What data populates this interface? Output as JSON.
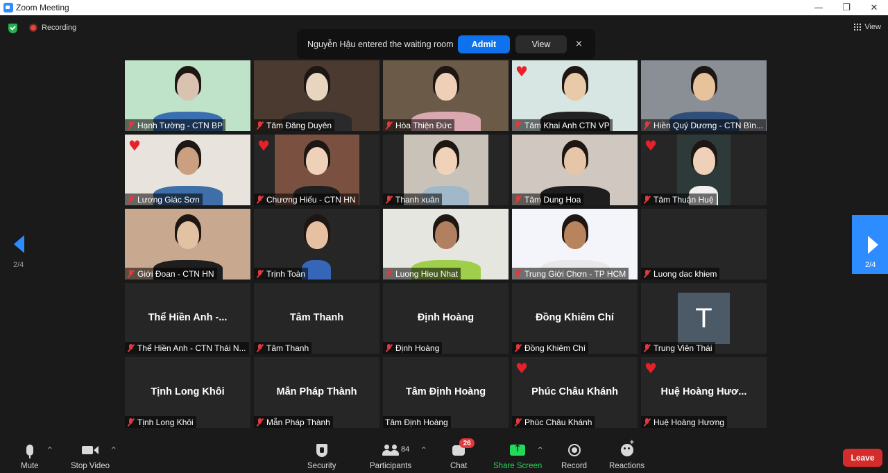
{
  "window": {
    "title": "Zoom Meeting",
    "controls": [
      "—",
      "❐",
      "✕"
    ]
  },
  "topbar": {
    "recording_label": "Recording",
    "view_label": "View"
  },
  "notice": {
    "message": "Nguyễn Hậu entered the waiting room",
    "admit_label": "Admit",
    "view_label": "View",
    "close_glyph": "×"
  },
  "pagination": {
    "left": "2/4",
    "right": "2/4"
  },
  "participants": [
    {
      "label": "Hạnh Tường - CTN BP",
      "video": true,
      "reaction": false
    },
    {
      "label": "Tâm Đăng Duyên",
      "video": true,
      "reaction": false
    },
    {
      "label": "Hòa Thiện Đức",
      "video": true,
      "reaction": false
    },
    {
      "label": "Tâm Khai Anh CTN VP",
      "video": true,
      "reaction": true
    },
    {
      "label": "Hiền Quý Dương - CTN Bìn...",
      "video": true,
      "reaction": false
    },
    {
      "label": "Lương Giác Sơn",
      "video": true,
      "reaction": true
    },
    {
      "label": "Chương Hiếu - CTN HN",
      "video": true,
      "reaction": true
    },
    {
      "label": "Thanh xuân",
      "video": true,
      "reaction": false
    },
    {
      "label": "Tâm Dung Hoa",
      "video": true,
      "reaction": false
    },
    {
      "label": "Tâm Thuận Huệ",
      "video": true,
      "reaction": true
    },
    {
      "label": "Giới Đoan - CTN HN",
      "video": true,
      "reaction": false
    },
    {
      "label": "Trịnh Toàn",
      "video": true,
      "reaction": false
    },
    {
      "label": "Luong Hieu Nhat",
      "video": true,
      "reaction": false
    },
    {
      "label": "Trung Giới Chơn - TP HCM",
      "video": true,
      "reaction": false
    },
    {
      "label": "Luong dac khiem",
      "video": false,
      "reaction": false,
      "big_name": ""
    },
    {
      "label": "Thể Hiền Anh - CTN Thái N...",
      "video": false,
      "reaction": false,
      "big_name": "Thể Hiền Anh -..."
    },
    {
      "label": "Tâm Thanh",
      "video": false,
      "reaction": false,
      "big_name": "Tâm Thanh"
    },
    {
      "label": "Định Hoàng",
      "video": false,
      "reaction": false,
      "big_name": "Định Hoàng"
    },
    {
      "label": "Đồng Khiêm Chí",
      "video": false,
      "reaction": false,
      "big_name": "Đồng Khiêm Chí"
    },
    {
      "label": "Trung Viên Thái",
      "video": false,
      "reaction": false,
      "big_name": "",
      "avatar_letter": "T"
    },
    {
      "label": "Tịnh Long Khôi",
      "video": false,
      "reaction": false,
      "big_name": "Tịnh Long Khôi"
    },
    {
      "label": "Mẫn Pháp Thành",
      "video": false,
      "reaction": false,
      "big_name": "Mẫn Pháp Thành"
    },
    {
      "label": "Tâm Định Hoàng",
      "video": false,
      "reaction": false,
      "big_name": "Tâm Định Hoàng",
      "unmuted": true
    },
    {
      "label": "Phúc Châu Khánh",
      "video": false,
      "reaction": true,
      "big_name": "Phúc Châu Khánh"
    },
    {
      "label": "Huệ Hoàng Hương",
      "video": false,
      "reaction": true,
      "big_name": "Huệ  Hoàng  Hươ..."
    }
  ],
  "toolbar": {
    "mute": "Mute",
    "stop_video": "Stop Video",
    "security": "Security",
    "participants": "Participants",
    "participants_count": "84",
    "chat": "Chat",
    "chat_badge": "26",
    "share_screen": "Share Screen",
    "record": "Record",
    "reactions": "Reactions",
    "leave": "Leave"
  },
  "colors": {
    "accent": "#2d8cff",
    "admit": "#0e72ed",
    "leave": "#d62b2b",
    "share": "#23d959",
    "muted": "#e0393e"
  }
}
